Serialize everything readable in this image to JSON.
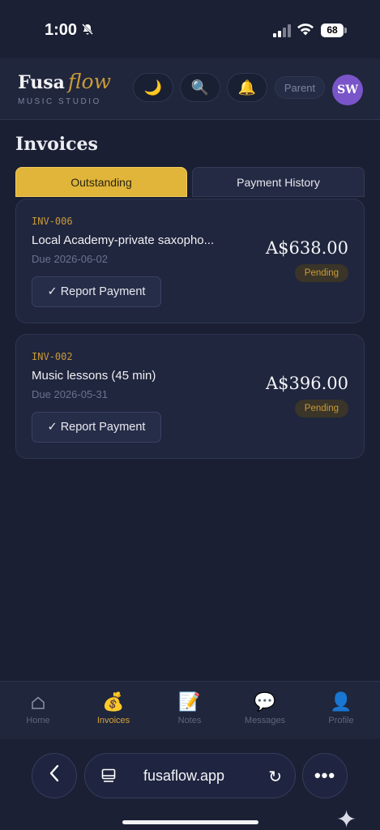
{
  "status_bar": {
    "time": "1:00",
    "battery": "68"
  },
  "header": {
    "logo_main": "Fusa",
    "logo_script": "flow",
    "logo_sub": "MUSIC STUDIO",
    "role_pill": "Parent",
    "avatar_initials": "SW"
  },
  "page": {
    "title": "Invoices"
  },
  "tabs": [
    {
      "label": "Outstanding",
      "active": true
    },
    {
      "label": "Payment History",
      "active": false
    }
  ],
  "invoices": [
    {
      "id": "INV-006",
      "description": "Local Academy-private saxopho...",
      "due": "Due 2026-06-02",
      "amount": "A$638.00",
      "status": "Pending",
      "action": "✓ Report Payment"
    },
    {
      "id": "INV-002",
      "description": "Music lessons (45 min)",
      "due": "Due 2026-05-31",
      "amount": "A$396.00",
      "status": "Pending",
      "action": "✓ Report Payment"
    }
  ],
  "bottom_nav": [
    {
      "label": "Home",
      "icon": "home-icon",
      "active": false
    },
    {
      "label": "Invoices",
      "icon": "money-bag-icon",
      "active": true
    },
    {
      "label": "Notes",
      "icon": "notepad-icon",
      "active": false
    },
    {
      "label": "Messages",
      "icon": "speech-bubble-icon",
      "active": false
    },
    {
      "label": "Profile",
      "icon": "user-silhouette-icon",
      "active": false
    }
  ],
  "browser": {
    "url": "fusaflow.app"
  },
  "colors": {
    "accent": "#e0b53a",
    "background": "#1a1f33",
    "card": "#20263d",
    "avatar": "#7a55c9"
  }
}
